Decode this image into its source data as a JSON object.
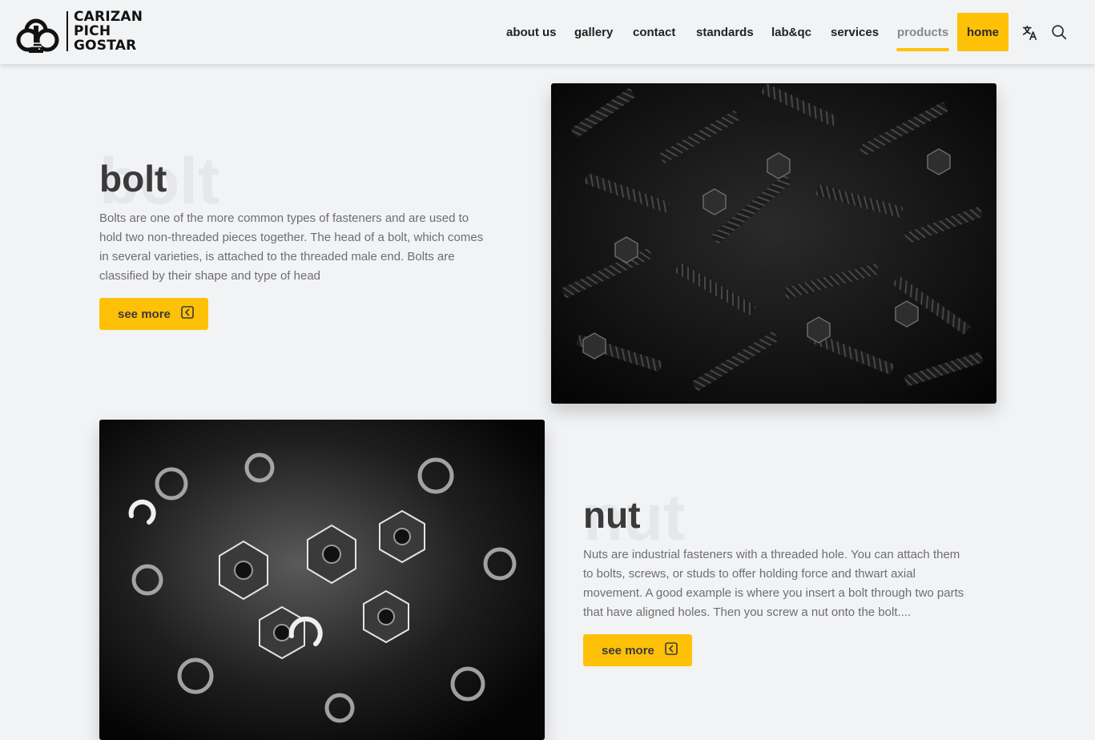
{
  "brand": {
    "logo_lines": [
      "CARIZAN",
      "PICH",
      "GOSTAR"
    ]
  },
  "nav": {
    "items": [
      {
        "label": "about us",
        "state": "normal"
      },
      {
        "label": "gallery",
        "state": "normal"
      },
      {
        "label": "contact",
        "state": "normal"
      },
      {
        "label": "standards",
        "state": "normal"
      },
      {
        "label": "lab&qc",
        "state": "normal"
      },
      {
        "label": "services",
        "state": "normal"
      },
      {
        "label": "products",
        "state": "active"
      },
      {
        "label": "home",
        "state": "highlighted"
      }
    ],
    "icons": [
      "translate-icon",
      "search-icon"
    ]
  },
  "sections": {
    "bolt": {
      "ghost": "bolt",
      "title": "bolt",
      "description": "Bolts are one of the more common types of fasteners and are used to hold two non-threaded pieces together. The head of a bolt, which comes in several varieties, is attached to the threaded male end. Bolts are classified by their shape and type of head",
      "button_label": "see more",
      "button_icon": "chevron-left-square-icon",
      "image_icon": "bolts-photo"
    },
    "nut": {
      "ghost": "nut",
      "title": "nut",
      "description": "Nuts are industrial fasteners with a threaded hole. You can attach them to bolts, screws, or studs to offer holding force and thwart axial movement. A good example is where you insert a bolt through two parts that have aligned holes. Then you screw a nut onto the bolt....",
      "button_label": "see more",
      "button_icon": "chevron-left-square-icon",
      "image_icon": "nuts-photo"
    }
  },
  "colors": {
    "accent": "#ffc107",
    "background": "#f2f3f5",
    "text_dark": "#3a3a3a",
    "text_muted": "#6e6e6e"
  }
}
